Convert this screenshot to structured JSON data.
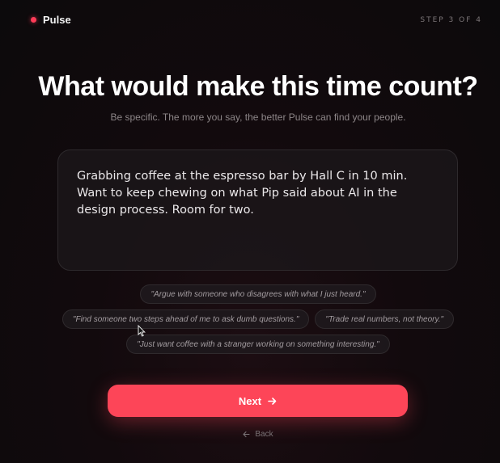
{
  "brand": {
    "name": "Pulse",
    "accent": "#ff3b57"
  },
  "progress": {
    "label": "STEP 3 OF 4",
    "current": 3,
    "total": 4
  },
  "heading": "What would make this time count?",
  "subheading": "Be specific. The more you say, the better Pulse can find your people.",
  "input": {
    "value": "Grabbing coffee at the espresso bar by Hall C in 10 min. Want to keep chewing on what Pip said about AI in the design process. Room for two."
  },
  "suggestions": [
    "\"Argue with someone who disagrees with what I just heard.\"",
    "\"Find someone two steps ahead of me to ask dumb questions.\"",
    "\"Trade real numbers, not theory.\"",
    "\"Just want coffee with a stranger working on something interesting.\""
  ],
  "actions": {
    "next_label": "Next",
    "next_icon": "arrow-right-icon",
    "back_label": "Back",
    "back_icon": "arrow-left-icon"
  }
}
